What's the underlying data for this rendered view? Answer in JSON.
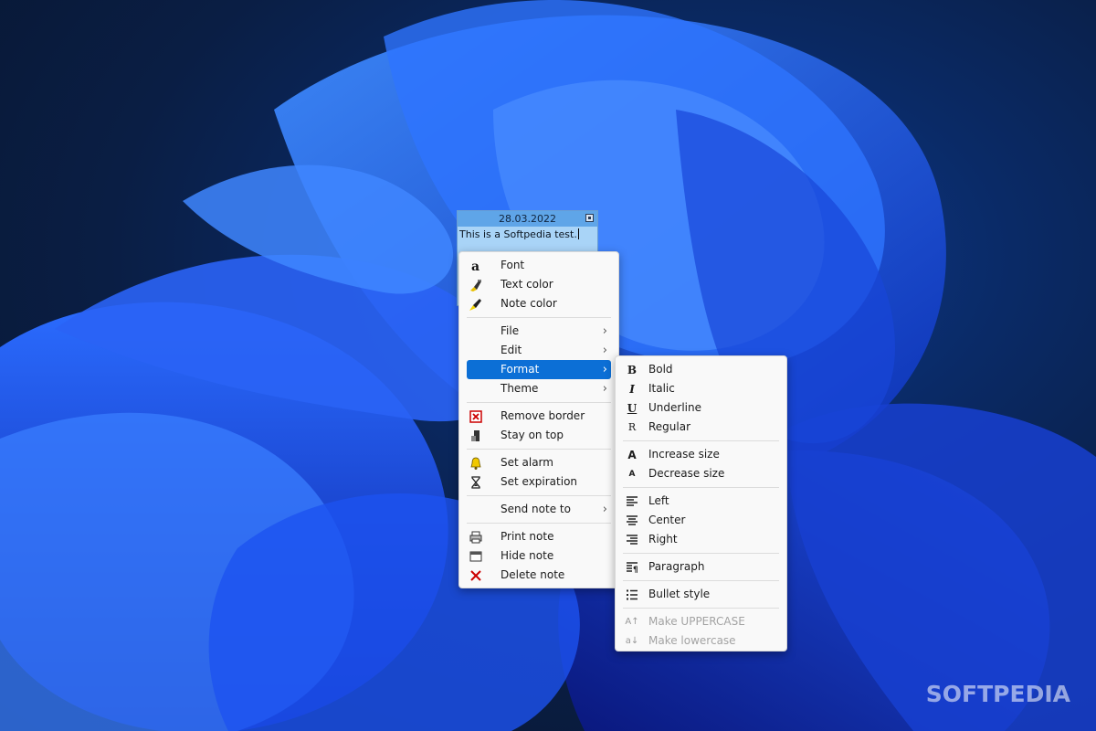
{
  "note": {
    "date": "28.03.2022",
    "text": "This is a Softpedia test."
  },
  "context_menu": {
    "items": [
      {
        "label": "Font",
        "icon": "font-a-icon"
      },
      {
        "label": "Text color",
        "icon": "text-color-icon"
      },
      {
        "label": "Note color",
        "icon": "note-color-icon"
      },
      {
        "label": "File",
        "submenu": true
      },
      {
        "label": "Edit",
        "submenu": true
      },
      {
        "label": "Format",
        "submenu": true,
        "highlighted": true
      },
      {
        "label": "Theme",
        "submenu": true
      },
      {
        "label": "Remove border",
        "icon": "remove-border-icon"
      },
      {
        "label": "Stay on top",
        "icon": "stay-on-top-icon"
      },
      {
        "label": "Set alarm",
        "icon": "bell-icon"
      },
      {
        "label": "Set expiration",
        "icon": "hourglass-icon"
      },
      {
        "label": "Send note to",
        "submenu": true
      },
      {
        "label": "Print note",
        "icon": "printer-icon"
      },
      {
        "label": "Hide note",
        "icon": "window-icon"
      },
      {
        "label": "Delete note",
        "icon": "delete-x-icon"
      }
    ],
    "submenu_arrow": "›"
  },
  "format_menu": {
    "items": [
      {
        "label": "Bold",
        "icon": "bold-icon",
        "glyph": "B"
      },
      {
        "label": "Italic",
        "icon": "italic-icon",
        "glyph": "I"
      },
      {
        "label": "Underline",
        "icon": "underline-icon",
        "glyph": "U"
      },
      {
        "label": "Regular",
        "icon": "regular-icon",
        "glyph": "R"
      },
      {
        "label": "Increase size",
        "icon": "increase-size-icon",
        "glyph": "A"
      },
      {
        "label": "Decrease size",
        "icon": "decrease-size-icon",
        "glyph": "A"
      },
      {
        "label": "Left",
        "icon": "align-left-icon"
      },
      {
        "label": "Center",
        "icon": "align-center-icon"
      },
      {
        "label": "Right",
        "icon": "align-right-icon"
      },
      {
        "label": "Paragraph",
        "icon": "paragraph-icon"
      },
      {
        "label": "Bullet style",
        "icon": "bullet-list-icon"
      },
      {
        "label": "Make UPPERCASE",
        "icon": "uppercase-icon",
        "glyph": "A↑",
        "disabled": true
      },
      {
        "label": "Make lowercase",
        "icon": "lowercase-icon",
        "glyph": "a↓",
        "disabled": true
      }
    ]
  },
  "watermark": "SOFTPEDIA",
  "colors": {
    "highlight": "#0c6fd6",
    "note_body": "#a9d4f7",
    "note_titlebar": "#5fa5e8"
  }
}
